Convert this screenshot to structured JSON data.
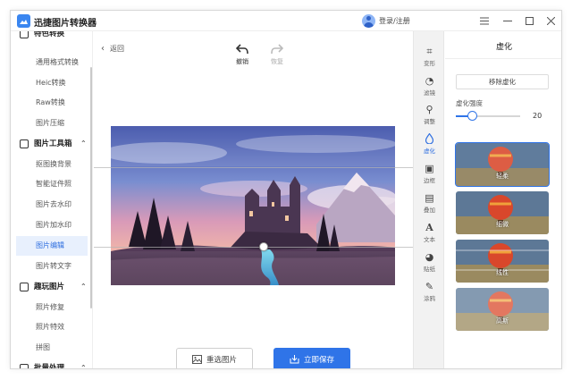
{
  "app": {
    "title": "迅捷图片转换器",
    "login_text": "登录/注册",
    "window_controls": [
      "menu-icon",
      "minimize-icon",
      "maximize-icon",
      "close-icon"
    ]
  },
  "sidebar": {
    "partial_top_label": "特色转换",
    "items_group1": [
      {
        "label": "通用格式转换"
      },
      {
        "label": "Heic转换"
      },
      {
        "label": "Raw转换"
      },
      {
        "label": "图片压缩"
      }
    ],
    "section_tools": {
      "label": "图片工具箱",
      "icon": "toolbox-icon"
    },
    "items_group2": [
      {
        "label": "抠图换背景"
      },
      {
        "label": "智能证件照"
      },
      {
        "label": "图片去水印"
      },
      {
        "label": "图片加水印"
      },
      {
        "label": "图片编辑",
        "active": true
      },
      {
        "label": "图片转文字"
      }
    ],
    "section_fun": {
      "label": "趣玩图片",
      "icon": "image-icon"
    },
    "items_group3": [
      {
        "label": "照片修复"
      },
      {
        "label": "照片特效"
      },
      {
        "label": "拼图"
      }
    ],
    "section_batch": {
      "label": "批量处理",
      "icon": "batch-icon"
    }
  },
  "main": {
    "back_label": "返回",
    "undo_label": "撤销",
    "redo_label": "恢复",
    "reselect_label": "重选图片",
    "save_label": "立即保存"
  },
  "vtoolbar": [
    {
      "label": "变形",
      "icon": "crop-icon"
    },
    {
      "label": "滤镜",
      "icon": "filter-icon"
    },
    {
      "label": "调整",
      "icon": "adjust-icon"
    },
    {
      "label": "虚化",
      "icon": "blur-drop-icon",
      "active": true
    },
    {
      "label": "边框",
      "icon": "frame-icon"
    },
    {
      "label": "叠加",
      "icon": "overlay-icon"
    },
    {
      "label": "文本",
      "icon": "text-icon"
    },
    {
      "label": "贴纸",
      "icon": "sticker-icon"
    },
    {
      "label": "涂鸦",
      "icon": "brush-icon"
    }
  ],
  "rpanel": {
    "title": "虚化",
    "remove_label": "移除虚化",
    "strength_label": "虚化强度",
    "strength_value": "20",
    "strength_fraction": 0.25,
    "presets": [
      {
        "label": "轻柔",
        "selected": true
      },
      {
        "label": "细微"
      },
      {
        "label": "线性"
      },
      {
        "label": "高斯"
      }
    ]
  },
  "colors": {
    "accent": "#2f74e8",
    "active_bg": "#e8f0fd"
  }
}
